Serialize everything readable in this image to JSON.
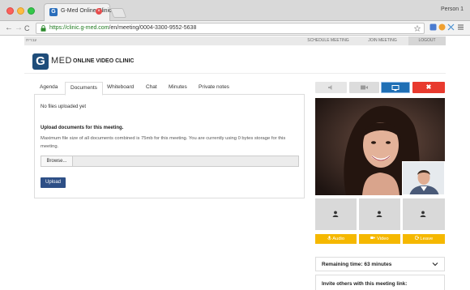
{
  "browser": {
    "tab_title": "G-Med Online Clinic",
    "tab_close": "×",
    "profile_name": "Person 1",
    "url_secure_part": "https://clinic.g-med.com",
    "url_path": "/en/meeting/0004-3300-9552-5638",
    "nav_back": "←",
    "nav_forward": "→",
    "nav_reload": "C"
  },
  "topbar": {
    "language": "עברית",
    "nav": {
      "schedule": "Schedule Meeting",
      "join": "Join Meeting",
      "logout": "Logout"
    }
  },
  "logo": {
    "letter": "G",
    "brand": "MED",
    "subtitle": "ONLINE VIDEO CLINIC"
  },
  "tabs": [
    {
      "label": "Agenda"
    },
    {
      "label": "Documents"
    },
    {
      "label": "Whiteboard"
    },
    {
      "label": "Chat"
    },
    {
      "label": "Minutes"
    },
    {
      "label": "Private notes"
    }
  ],
  "active_tab": "Documents",
  "documents": {
    "empty_text": "No files uploaded yet",
    "upload_title": "Upload documents for this meeting.",
    "upload_desc": "Maximum file size of all documents combined is 75mb for this meeting. You are currently using 0 bytes storage for this meeting.",
    "browse_label": "Browse...",
    "upload_label": "Upload"
  },
  "controls": {
    "end_label": "✖"
  },
  "actions": {
    "audio": "Audio",
    "video": "Video",
    "leave": "Leave"
  },
  "meeting": {
    "remaining_time": "Remaining time: 63 minutes",
    "invite_text": "Invite others with this meeting link:"
  },
  "colors": {
    "primary": "#2e4f86",
    "accent_yellow": "#f5b800",
    "danger": "#e83a2e",
    "screen_share": "#1f6fb5"
  }
}
